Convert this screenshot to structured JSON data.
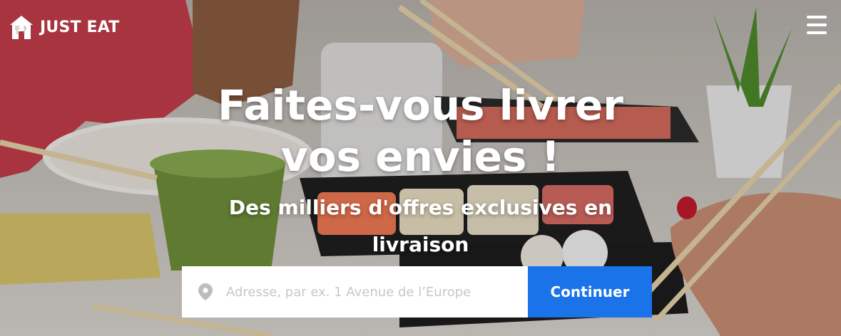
{
  "brand": {
    "name": "JUST EAT",
    "logo_icon": "house-cutlery-icon",
    "text_color": "#ffffff"
  },
  "header": {
    "menu_icon": "hamburger-menu-icon"
  },
  "hero": {
    "title": "Faites-vous livrer vos envies !",
    "subtitle": "Des milliers d'offres exclusives en livraison"
  },
  "search": {
    "address_placeholder": "Adresse, par ex. 1 Avenue de l’Europe",
    "address_value": "",
    "location_icon": "location-pin-icon",
    "submit_label": "Continuer",
    "button_color": "#1a73e8"
  }
}
